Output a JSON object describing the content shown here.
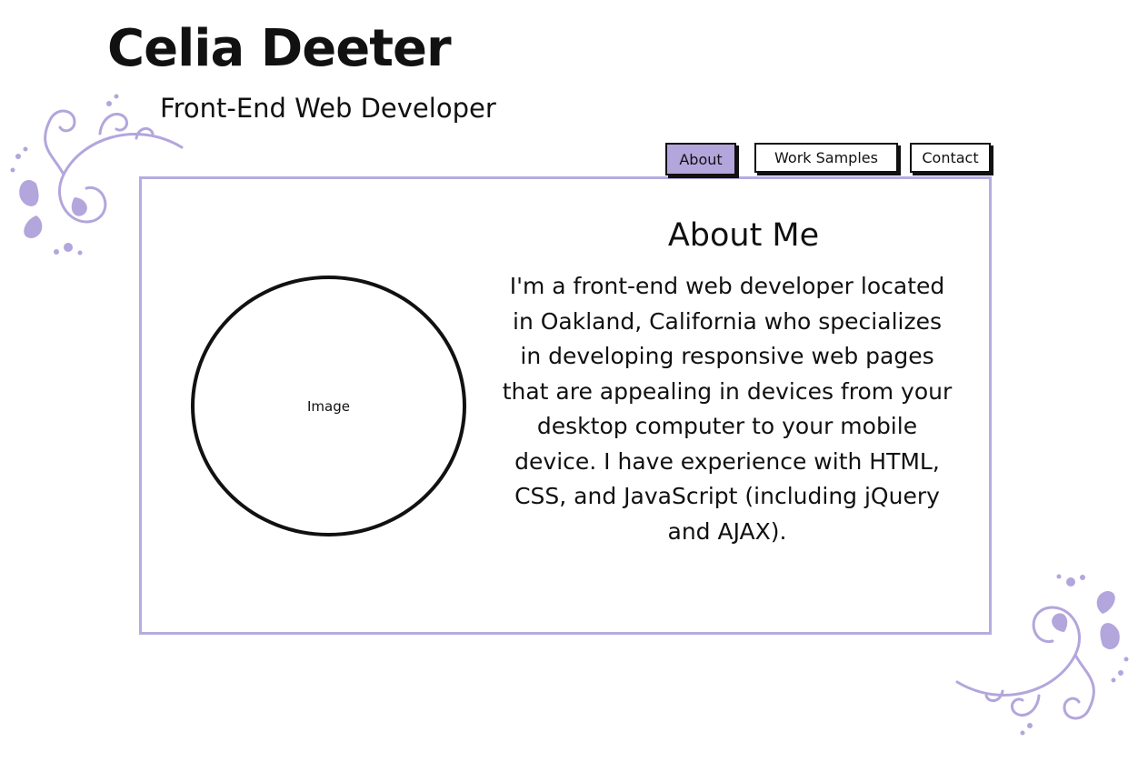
{
  "header": {
    "name": "Celia Deeter",
    "tagline": "Front-End Web Developer"
  },
  "nav": {
    "items": [
      {
        "label": "About",
        "active": true
      },
      {
        "label": "Work Samples",
        "active": false
      },
      {
        "label": "Contact",
        "active": false
      }
    ]
  },
  "main": {
    "image_label": "Image",
    "heading": "About Me",
    "body": "I'm a front-end web developer located in Oakland, California who specializes in developing responsive web pages that are appealing in devices from your desktop computer to your mobile device. I have experience with HTML, CSS, and JavaScript (including jQuery and AJAX)."
  },
  "decorations": {
    "icons": [
      "swirl-ornament-icon",
      "swirl-ornament-icon"
    ]
  },
  "colors": {
    "accent": "#b3a6dc",
    "border": "#b6ace0",
    "text": "#111111",
    "background": "#ffffff"
  }
}
